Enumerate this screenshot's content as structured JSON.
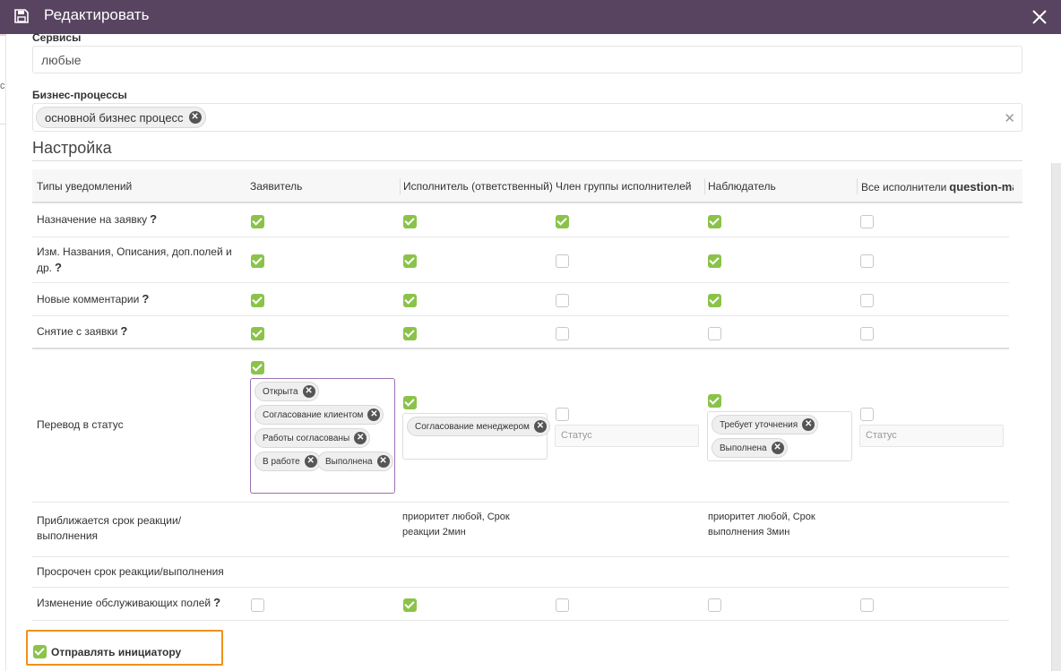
{
  "dialog": {
    "title": "Редактировать"
  },
  "background": {
    "fragment": "с"
  },
  "services": {
    "label": "Сервисы",
    "value": "любые"
  },
  "business_processes": {
    "label": "Бизнес-процессы",
    "tag": "основной бизнес процесс"
  },
  "settings": {
    "title": "Настройка",
    "columns": [
      "Типы уведомлений",
      "Заявитель",
      "Исполнитель (ответственный)",
      "Член группы исполнителей",
      "Наблюдатель",
      "Все исполнители"
    ],
    "rows": [
      {
        "label": "Назначение на заявку",
        "help": "?",
        "checks": [
          true,
          true,
          true,
          true,
          false
        ]
      },
      {
        "label": "Изм. Названия, Описания, доп.полей и др.",
        "help": "?",
        "checks": [
          true,
          true,
          false,
          true,
          false
        ]
      },
      {
        "label": "Новые комментарии",
        "help": "?",
        "checks": [
          true,
          true,
          false,
          true,
          false
        ]
      },
      {
        "label": "Снятие с заявки",
        "help": "?",
        "checks": [
          true,
          true,
          false,
          false,
          false
        ]
      }
    ],
    "status_row": {
      "label": "Перевод в статус",
      "checks": [
        true,
        true,
        false,
        true,
        false
      ],
      "applicant_tags": [
        "Открыта",
        "Согласование клиентом",
        "Работы согласованы",
        "В работе",
        "Выполнена"
      ],
      "executor_tags": [
        "Согласование менеджером"
      ],
      "group_placeholder": "Статус",
      "observer_tags": [
        "Требует уточнения",
        "Выполнена"
      ],
      "all_placeholder": "Статус"
    },
    "approaching": {
      "label": "Приближается срок реакции/ выполнения",
      "executor_text": "приоритет любой, Срок реакции 2мин",
      "observer_text": "приоритет любой, Срок выполнения 3мин"
    },
    "overdue": {
      "label": "Просрочен срок реакции/выполнения"
    },
    "service_fields": {
      "label": "Изменение обслуживающих полей",
      "help": "?",
      "checks": [
        false,
        true,
        false,
        false,
        false
      ]
    }
  },
  "send_initiator": {
    "label": "Отправлять инициатору",
    "checked": true
  },
  "icons": {
    "save": "floppy-disk-icon",
    "close": "close-icon",
    "tag_remove": "circle-x-icon",
    "clear": "clear-icon",
    "help": "question-mark-icon"
  },
  "colors": {
    "titlebar": "#584460",
    "check_on": "#8bc34a",
    "highlight": "#f0901a",
    "active_border": "#9c6fb5"
  }
}
